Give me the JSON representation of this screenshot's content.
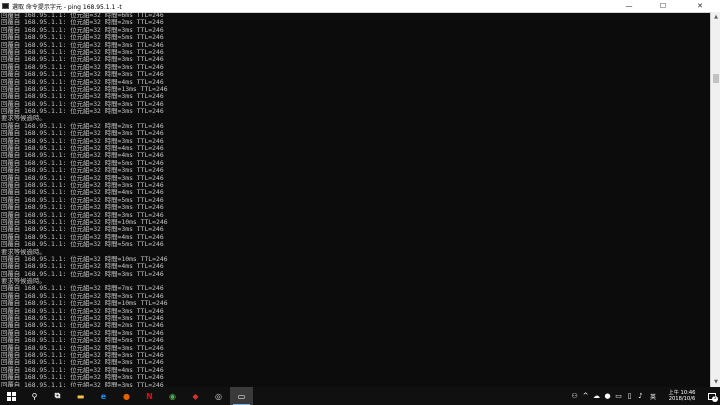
{
  "window": {
    "title": "選取 命令提示字元 - ping  168.95.1.1 -t",
    "controls": {
      "minimize": "—",
      "maximize": "☐",
      "close": "✕"
    }
  },
  "console": {
    "lines": [
      "回覆自 168.95.1.1: 位元組=32 時間=6ms TTL=246",
      "回覆自 168.95.1.1: 位元組=32 時間=2ms TTL=246",
      "回覆自 168.95.1.1: 位元組=32 時間=3ms TTL=246",
      "回覆自 168.95.1.1: 位元組=32 時間=5ms TTL=246",
      "回覆自 168.95.1.1: 位元組=32 時間=3ms TTL=246",
      "回覆自 168.95.1.1: 位元組=32 時間=3ms TTL=246",
      "回覆自 168.95.1.1: 位元組=32 時間=3ms TTL=246",
      "回覆自 168.95.1.1: 位元組=32 時間=3ms TTL=246",
      "回覆自 168.95.1.1: 位元組=32 時間=3ms TTL=246",
      "回覆自 168.95.1.1: 位元組=32 時間=4ms TTL=246",
      "回覆自 168.95.1.1: 位元組=32 時間=13ms TTL=246",
      "回覆自 168.95.1.1: 位元組=32 時間=3ms TTL=246",
      "回覆自 168.95.1.1: 位元組=32 時間=3ms TTL=246",
      "回覆自 168.95.1.1: 位元組=32 時間=3ms TTL=246",
      "要求等候逾時。",
      "回覆自 168.95.1.1: 位元組=32 時間=2ms TTL=246",
      "回覆自 168.95.1.1: 位元組=32 時間=3ms TTL=246",
      "回覆自 168.95.1.1: 位元組=32 時間=3ms TTL=246",
      "回覆自 168.95.1.1: 位元組=32 時間=4ms TTL=246",
      "回覆自 168.95.1.1: 位元組=32 時間=4ms TTL=246",
      "回覆自 168.95.1.1: 位元組=32 時間=5ms TTL=246",
      "回覆自 168.95.1.1: 位元組=32 時間=3ms TTL=246",
      "回覆自 168.95.1.1: 位元組=32 時間=3ms TTL=246",
      "回覆自 168.95.1.1: 位元組=32 時間=3ms TTL=246",
      "回覆自 168.95.1.1: 位元組=32 時間=4ms TTL=246",
      "回覆自 168.95.1.1: 位元組=32 時間=5ms TTL=246",
      "回覆自 168.95.1.1: 位元組=32 時間=3ms TTL=246",
      "回覆自 168.95.1.1: 位元組=32 時間=3ms TTL=246",
      "回覆自 168.95.1.1: 位元組=32 時間=10ms TTL=246",
      "回覆自 168.95.1.1: 位元組=32 時間=3ms TTL=246",
      "回覆自 168.95.1.1: 位元組=32 時間=4ms TTL=246",
      "回覆自 168.95.1.1: 位元組=32 時間=5ms TTL=246",
      "要求等候逾時。",
      "回覆自 168.95.1.1: 位元組=32 時間=10ms TTL=246",
      "回覆自 168.95.1.1: 位元組=32 時間=4ms TTL=246",
      "回覆自 168.95.1.1: 位元組=32 時間=3ms TTL=246",
      "要求等候逾時。",
      "回覆自 168.95.1.1: 位元組=32 時間=7ms TTL=246",
      "回覆自 168.95.1.1: 位元組=32 時間=3ms TTL=246",
      "回覆自 168.95.1.1: 位元組=32 時間=10ms TTL=246",
      "回覆自 168.95.1.1: 位元組=32 時間=3ms TTL=246",
      "回覆自 168.95.1.1: 位元組=32 時間=3ms TTL=246",
      "回覆自 168.95.1.1: 位元組=32 時間=2ms TTL=246",
      "回覆自 168.95.1.1: 位元組=32 時間=3ms TTL=246",
      "回覆自 168.95.1.1: 位元組=32 時間=5ms TTL=246",
      "回覆自 168.95.1.1: 位元組=32 時間=3ms TTL=246",
      "回覆自 168.95.1.1: 位元組=32 時間=3ms TTL=246",
      "回覆自 168.95.1.1: 位元組=32 時間=3ms TTL=246",
      "回覆自 168.95.1.1: 位元組=32 時間=4ms TTL=246",
      "回覆自 168.95.1.1: 位元組=32 時間=3ms TTL=246",
      "回覆自 168.95.1.1: 位元組=32 時間=3ms TTL=246"
    ]
  },
  "taskbar": {
    "apps": [
      {
        "name": "search-taskbar-icon",
        "glyph": "⚲",
        "color": "#ffffff"
      },
      {
        "name": "task-view-icon",
        "glyph": "⧉",
        "color": "#ffffff"
      },
      {
        "name": "file-explorer-icon",
        "glyph": "▬",
        "color": "#f4c542"
      },
      {
        "name": "edge-icon",
        "glyph": "e",
        "color": "#1e90ff"
      },
      {
        "name": "firefox-icon",
        "glyph": "●",
        "color": "#e66000"
      },
      {
        "name": "netflix-icon",
        "glyph": "N",
        "color": "#e50914"
      },
      {
        "name": "chrome-icon",
        "glyph": "◉",
        "color": "#4caf50"
      },
      {
        "name": "red-app-icon",
        "glyph": "◆",
        "color": "#d32f2f"
      },
      {
        "name": "disc-app-icon",
        "glyph": "◎",
        "color": "#d0d0d0"
      },
      {
        "name": "cmd-taskbar-icon",
        "glyph": "▭",
        "color": "#ffffff",
        "active": true
      }
    ],
    "tray": {
      "icons": [
        "⚇",
        "^",
        "☁",
        "●",
        "▭",
        "▯",
        "♪"
      ],
      "ime": "英",
      "time": "上午 10:46",
      "date": "2018/10/6",
      "notification_count": "5"
    }
  }
}
